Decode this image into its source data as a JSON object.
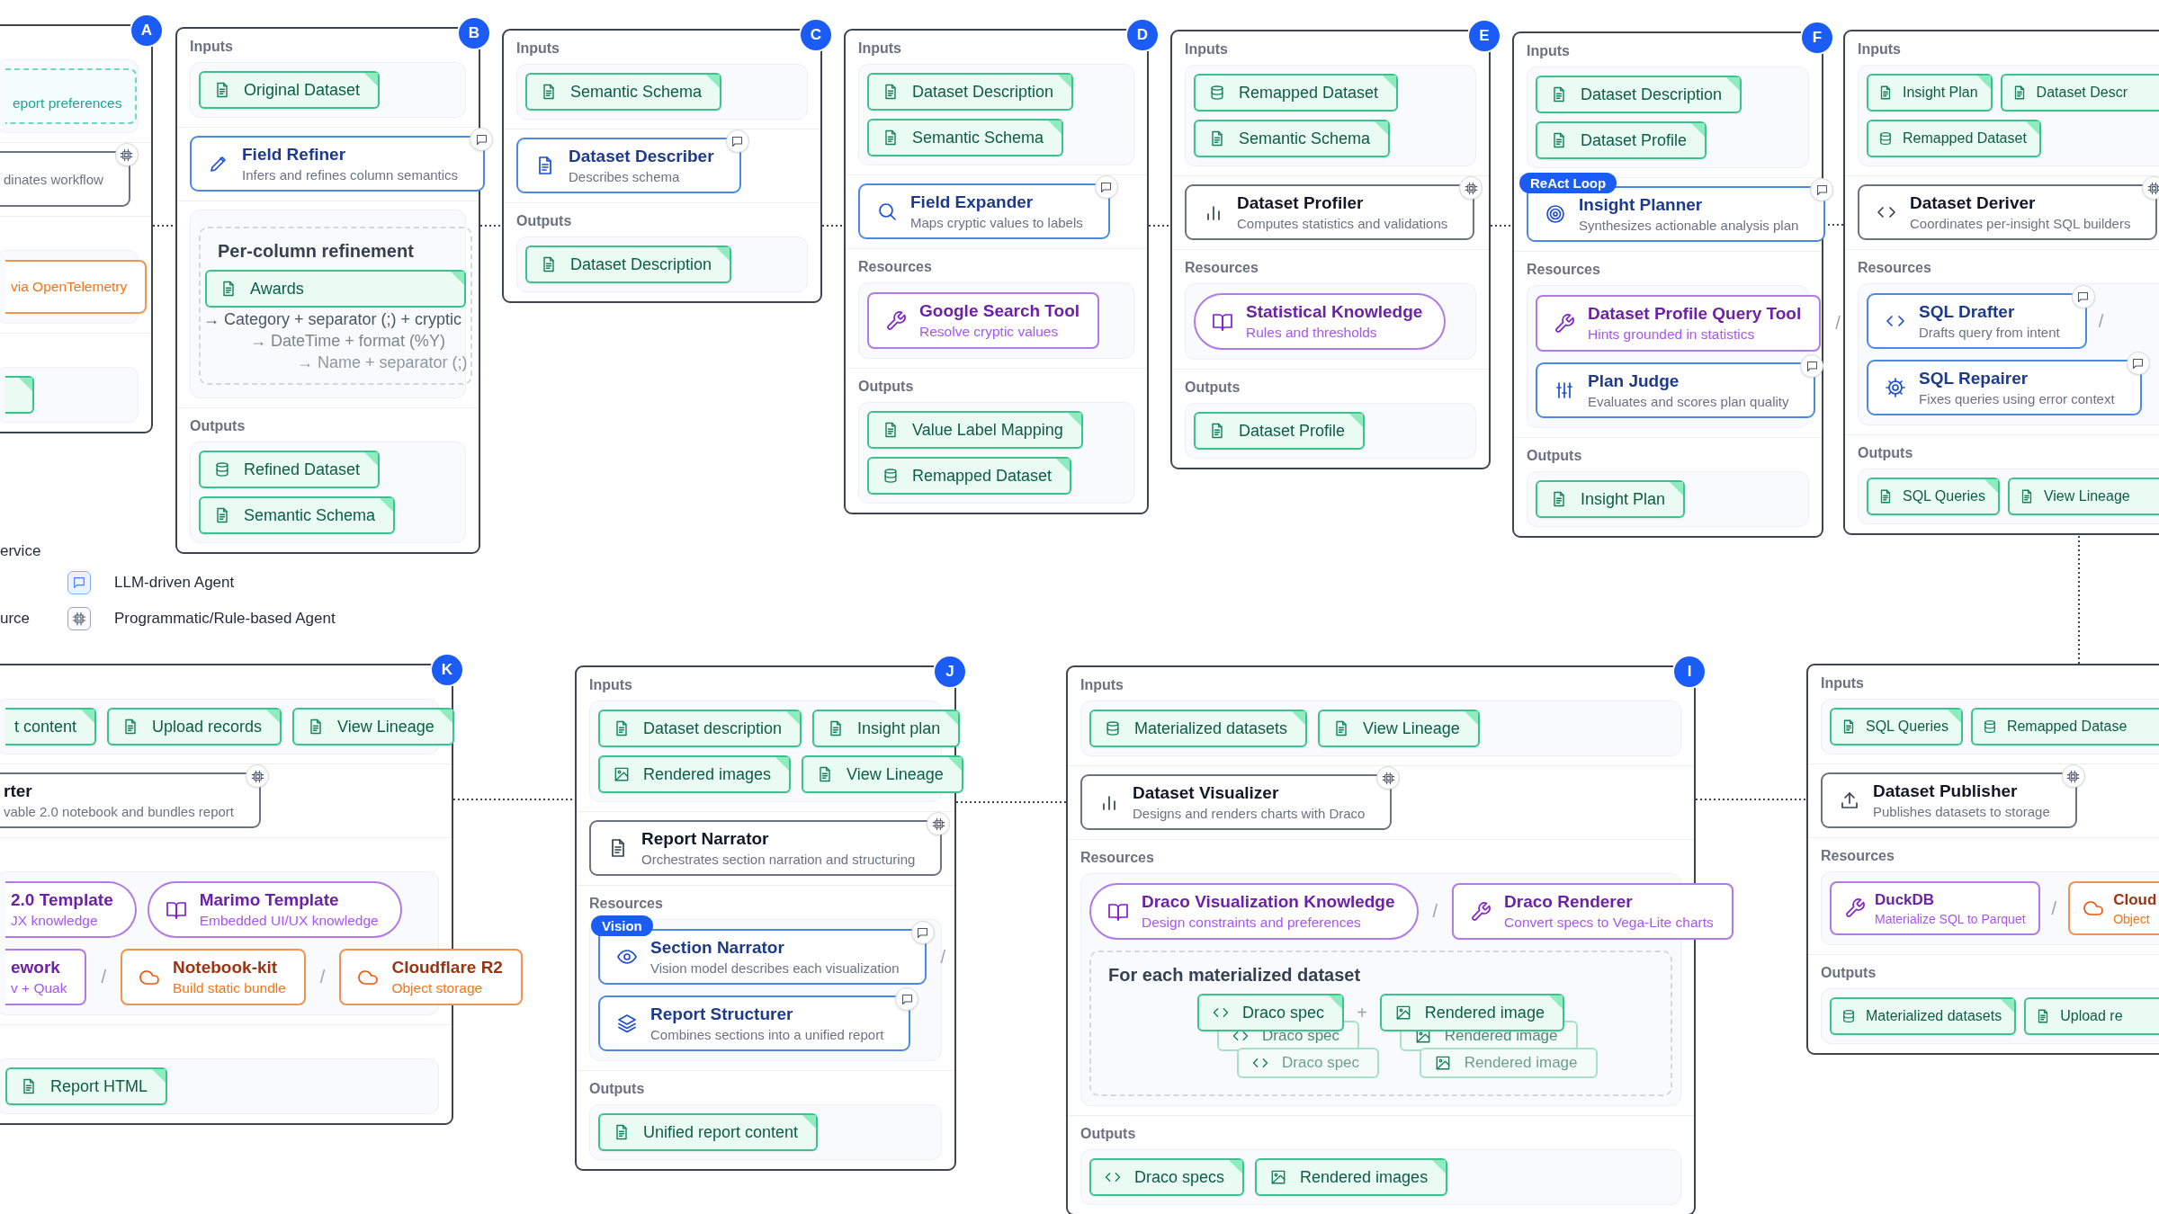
{
  "panels": [
    {
      "badge": "A",
      "sections": [
        {
          "kind": "io",
          "rows": [
            [
              {
                "kind": "note",
                "text": "eport preferences"
              }
            ]
          ]
        },
        {
          "kind": "agent",
          "rows": [
            [
              {
                "kind": "program",
                "desc": "dinates workflow"
              }
            ]
          ]
        },
        {
          "kind": "resources",
          "rows": [
            [
              {
                "kind": "service",
                "desc": "via OpenTelemetry"
              }
            ]
          ]
        },
        {
          "kind": "io",
          "rows": [
            [
              {
                "kind": "document"
              }
            ]
          ]
        }
      ]
    },
    {
      "badge": "B",
      "sections": [
        {
          "kind": "io",
          "label": "Inputs",
          "rows": [
            [
              {
                "kind": "document",
                "text": "Original Dataset"
              }
            ]
          ]
        },
        {
          "kind": "agent",
          "rows": [
            [
              {
                "kind": "llm",
                "title": "Field Refiner",
                "desc": "Infers and refines column semantics"
              }
            ]
          ]
        },
        {
          "kind": "group",
          "rows": [
            [
              {
                "kind": "loop",
                "title": "Per-column refinement",
                "chip": {
                  "kind": "document",
                  "text": "Awards"
                },
                "lines": [
                  {
                    "text": "→ Category + separator (;) + cryptic",
                    "ghost": false
                  },
                  {
                    "text": "→ DateTime + format (%Y)",
                    "ghost": true
                  },
                  {
                    "text": "→ Name + separator (;)",
                    "ghost": true
                  }
                ]
              }
            ]
          ]
        },
        {
          "kind": "io",
          "label": "Outputs",
          "rows": [
            [
              {
                "kind": "dataset",
                "text": "Refined Dataset"
              }
            ],
            [
              {
                "kind": "document",
                "text": "Semantic Schema"
              }
            ]
          ]
        }
      ]
    },
    {
      "badge": "C",
      "sections": [
        {
          "kind": "io",
          "label": "Inputs",
          "rows": [
            [
              {
                "kind": "document",
                "text": "Semantic Schema"
              }
            ]
          ]
        },
        {
          "kind": "agent",
          "rows": [
            [
              {
                "kind": "llm",
                "title": "Dataset Describer",
                "desc": "Describes schema"
              }
            ]
          ]
        },
        {
          "kind": "io",
          "label": "Outputs",
          "rows": [
            [
              {
                "kind": "document",
                "text": "Dataset Description"
              }
            ]
          ]
        }
      ]
    },
    {
      "badge": "D",
      "sections": [
        {
          "kind": "io",
          "label": "Inputs",
          "rows": [
            [
              {
                "kind": "document",
                "text": "Dataset Description"
              }
            ],
            [
              {
                "kind": "document",
                "text": "Semantic Schema"
              }
            ]
          ]
        },
        {
          "kind": "agent",
          "rows": [
            [
              {
                "kind": "llm",
                "title": "Field Expander",
                "desc": "Maps cryptic values to labels"
              }
            ]
          ]
        },
        {
          "kind": "resources",
          "label": "Resources",
          "rows": [
            [
              {
                "kind": "tool",
                "title": "Google Search Tool",
                "desc": "Resolve cryptic values"
              }
            ]
          ]
        },
        {
          "kind": "io",
          "label": "Outputs",
          "rows": [
            [
              {
                "kind": "document",
                "text": "Value Label Mapping"
              }
            ],
            [
              {
                "kind": "dataset",
                "text": "Remapped Dataset"
              }
            ]
          ]
        }
      ]
    },
    {
      "badge": "E",
      "sections": [
        {
          "kind": "io",
          "label": "Inputs",
          "rows": [
            [
              {
                "kind": "dataset",
                "text": "Remapped Dataset"
              }
            ],
            [
              {
                "kind": "document",
                "text": "Semantic Schema"
              }
            ]
          ]
        },
        {
          "kind": "agent",
          "rows": [
            [
              {
                "kind": "program",
                "title": "Dataset Profiler",
                "desc": "Computes statistics and validations"
              }
            ]
          ]
        },
        {
          "kind": "resources",
          "label": "Resources",
          "rows": [
            [
              {
                "kind": "knowledge",
                "title": "Statistical Knowledge",
                "desc": "Rules and thresholds"
              }
            ]
          ]
        },
        {
          "kind": "io",
          "label": "Outputs",
          "rows": [
            [
              {
                "kind": "document",
                "text": "Dataset Profile"
              }
            ]
          ]
        }
      ]
    },
    {
      "badge": "F",
      "sections": [
        {
          "kind": "io",
          "label": "Inputs",
          "rows": [
            [
              {
                "kind": "document",
                "text": "Dataset Description"
              }
            ],
            [
              {
                "kind": "document",
                "text": "Dataset Profile"
              }
            ]
          ]
        },
        {
          "kind": "agent",
          "rows": [
            [
              {
                "kind": "llm",
                "title": "Insight Planner",
                "desc": "Synthesizes actionable analysis plan",
                "tag": "ReAct Loop"
              }
            ]
          ]
        },
        {
          "kind": "resources",
          "label": "Resources",
          "rows": [
            [
              {
                "kind": "tool",
                "title": "Dataset Profile Query Tool",
                "desc": "Hints grounded in statistics",
                "sep": "/"
              }
            ],
            [
              {
                "kind": "llm",
                "title": "Plan Judge",
                "desc": "Evaluates and scores plan quality"
              }
            ]
          ]
        },
        {
          "kind": "io",
          "label": "Outputs",
          "rows": [
            [
              {
                "kind": "document",
                "text": "Insight Plan"
              }
            ]
          ]
        }
      ]
    },
    {
      "sections": [
        {
          "kind": "io",
          "label": "Inputs",
          "rows": [
            [
              {
                "kind": "document",
                "text": "Insight Plan"
              },
              {
                "kind": "document",
                "text": "Dataset Descr"
              }
            ],
            [
              {
                "kind": "dataset",
                "text": "Remapped Dataset"
              }
            ]
          ]
        },
        {
          "kind": "agent",
          "rows": [
            [
              {
                "kind": "program",
                "title": "Dataset Deriver",
                "desc": "Coordinates per-insight SQL builders"
              }
            ]
          ]
        },
        {
          "kind": "resources",
          "label": "Resources",
          "rows": [
            [
              {
                "kind": "llm",
                "title": "SQL Drafter",
                "desc": "Drafts query from intent",
                "sep": "/"
              }
            ],
            [
              {
                "kind": "llm",
                "title": "SQL Repairer",
                "desc": "Fixes queries using error context"
              }
            ]
          ]
        },
        {
          "kind": "io",
          "label": "Outputs",
          "rows": [
            [
              {
                "kind": "document",
                "text": "SQL Queries"
              },
              {
                "kind": "document",
                "text": "View Lineage"
              }
            ]
          ]
        }
      ]
    },
    {
      "badge": "K",
      "sections": [
        {
          "kind": "io",
          "rows": [
            [
              {
                "kind": "document",
                "text": "t content"
              },
              {
                "kind": "document",
                "text": "Upload records"
              },
              {
                "kind": "document",
                "text": "View Lineage"
              }
            ]
          ]
        },
        {
          "kind": "agent",
          "rows": [
            [
              {
                "kind": "program",
                "title": "rter",
                "desc": "vable 2.0 notebook and bundles report"
              }
            ]
          ]
        },
        {
          "kind": "resources",
          "rows": [
            [
              {
                "kind": "knowledge",
                "title": "2.0 Template",
                "desc": "JX knowledge"
              },
              {
                "kind": "knowledge",
                "title": "Marimo Template",
                "desc": "Embedded UI/UX knowledge"
              }
            ],
            [
              {
                "kind": "tool",
                "title": "ework",
                "desc": "v + Quak",
                "sep": "/"
              },
              {
                "kind": "service",
                "title": "Notebook-kit",
                "desc": "Build static bundle",
                "sep": "/"
              },
              {
                "kind": "service",
                "title": "Cloudflare R2",
                "desc": "Object storage"
              }
            ]
          ]
        },
        {
          "kind": "io",
          "rows": [
            [
              {
                "kind": "document",
                "text": "Report HTML"
              }
            ]
          ]
        }
      ]
    },
    {
      "badge": "J",
      "sections": [
        {
          "kind": "io",
          "label": "Inputs",
          "rows": [
            [
              {
                "kind": "document",
                "text": "Dataset description"
              },
              {
                "kind": "document",
                "text": "Insight plan"
              }
            ],
            [
              {
                "kind": "image",
                "text": "Rendered images"
              },
              {
                "kind": "document",
                "text": "View Lineage"
              }
            ]
          ]
        },
        {
          "kind": "agent",
          "rows": [
            [
              {
                "kind": "program",
                "title": "Report Narrator",
                "desc": "Orchestrates section narration and structuring"
              }
            ]
          ]
        },
        {
          "kind": "resources",
          "label": "Resources",
          "rows": [
            [
              {
                "kind": "llm",
                "title": "Section Narrator",
                "desc": "Vision model describes each visualization",
                "tag": "Vision",
                "sep": "/"
              }
            ],
            [
              {
                "kind": "llm",
                "title": "Report Structurer",
                "desc": "Combines sections into a unified report"
              }
            ]
          ]
        },
        {
          "kind": "io",
          "label": "Outputs",
          "rows": [
            [
              {
                "kind": "document",
                "text": "Unified report content"
              }
            ]
          ]
        }
      ]
    },
    {
      "badge": "I",
      "sections": [
        {
          "kind": "io",
          "label": "Inputs",
          "rows": [
            [
              {
                "kind": "dataset",
                "text": "Materialized datasets"
              },
              {
                "kind": "document",
                "text": "View Lineage"
              }
            ]
          ]
        },
        {
          "kind": "agent",
          "rows": [
            [
              {
                "kind": "program",
                "title": "Dataset Visualizer",
                "desc": "Designs and renders charts with Draco"
              }
            ]
          ]
        },
        {
          "kind": "resources",
          "label": "Resources",
          "rows": [
            [
              {
                "kind": "knowledge",
                "title": "Draco Visualization Knowledge",
                "desc": "Design constraints and preferences",
                "sep": "/"
              },
              {
                "kind": "tool",
                "title": "Draco Renderer",
                "desc": "Convert specs to Vega-Lite charts"
              }
            ],
            [
              {
                "kind": "loop",
                "title": "For each materialized dataset",
                "joiner": "+",
                "stacks": [
                  {
                    "kind": "spec",
                    "text": "Draco spec",
                    "ghosts": [
                      "Draco spec",
                      "Draco spec"
                    ]
                  },
                  {
                    "kind": "image",
                    "text": "Rendered image",
                    "ghosts": [
                      "Rendered image",
                      "Rendered image"
                    ]
                  }
                ]
              }
            ]
          ]
        },
        {
          "kind": "io",
          "label": "Outputs",
          "rows": [
            [
              {
                "kind": "spec",
                "text": "Draco specs"
              },
              {
                "kind": "image",
                "text": "Rendered images"
              }
            ]
          ]
        }
      ]
    },
    {
      "sections": [
        {
          "kind": "io",
          "label": "Inputs",
          "rows": [
            [
              {
                "kind": "document",
                "text": "SQL Queries"
              },
              {
                "kind": "dataset",
                "text": "Remapped Datase"
              }
            ]
          ]
        },
        {
          "kind": "agent",
          "rows": [
            [
              {
                "kind": "program",
                "title": "Dataset Publisher",
                "desc": "Publishes datasets to storage"
              }
            ]
          ]
        },
        {
          "kind": "resources",
          "label": "Resources",
          "rows": [
            [
              {
                "kind": "tool",
                "title": "DuckDB",
                "desc": "Materialize SQL to Parquet",
                "sep": "/"
              },
              {
                "kind": "service",
                "title": "Cloud",
                "desc": "Object"
              }
            ]
          ]
        },
        {
          "kind": "io",
          "label": "Outputs",
          "rows": [
            [
              {
                "kind": "dataset",
                "text": "Materialized datasets"
              },
              {
                "kind": "document",
                "text": "Upload re"
              }
            ]
          ]
        }
      ]
    }
  ],
  "legend": {
    "notes": [
      "ervice",
      "urce"
    ],
    "items": [
      {
        "kind": "llm",
        "text": "LLM-driven Agent"
      },
      {
        "kind": "program",
        "text": "Programmatic/Rule-based Agent"
      }
    ]
  }
}
